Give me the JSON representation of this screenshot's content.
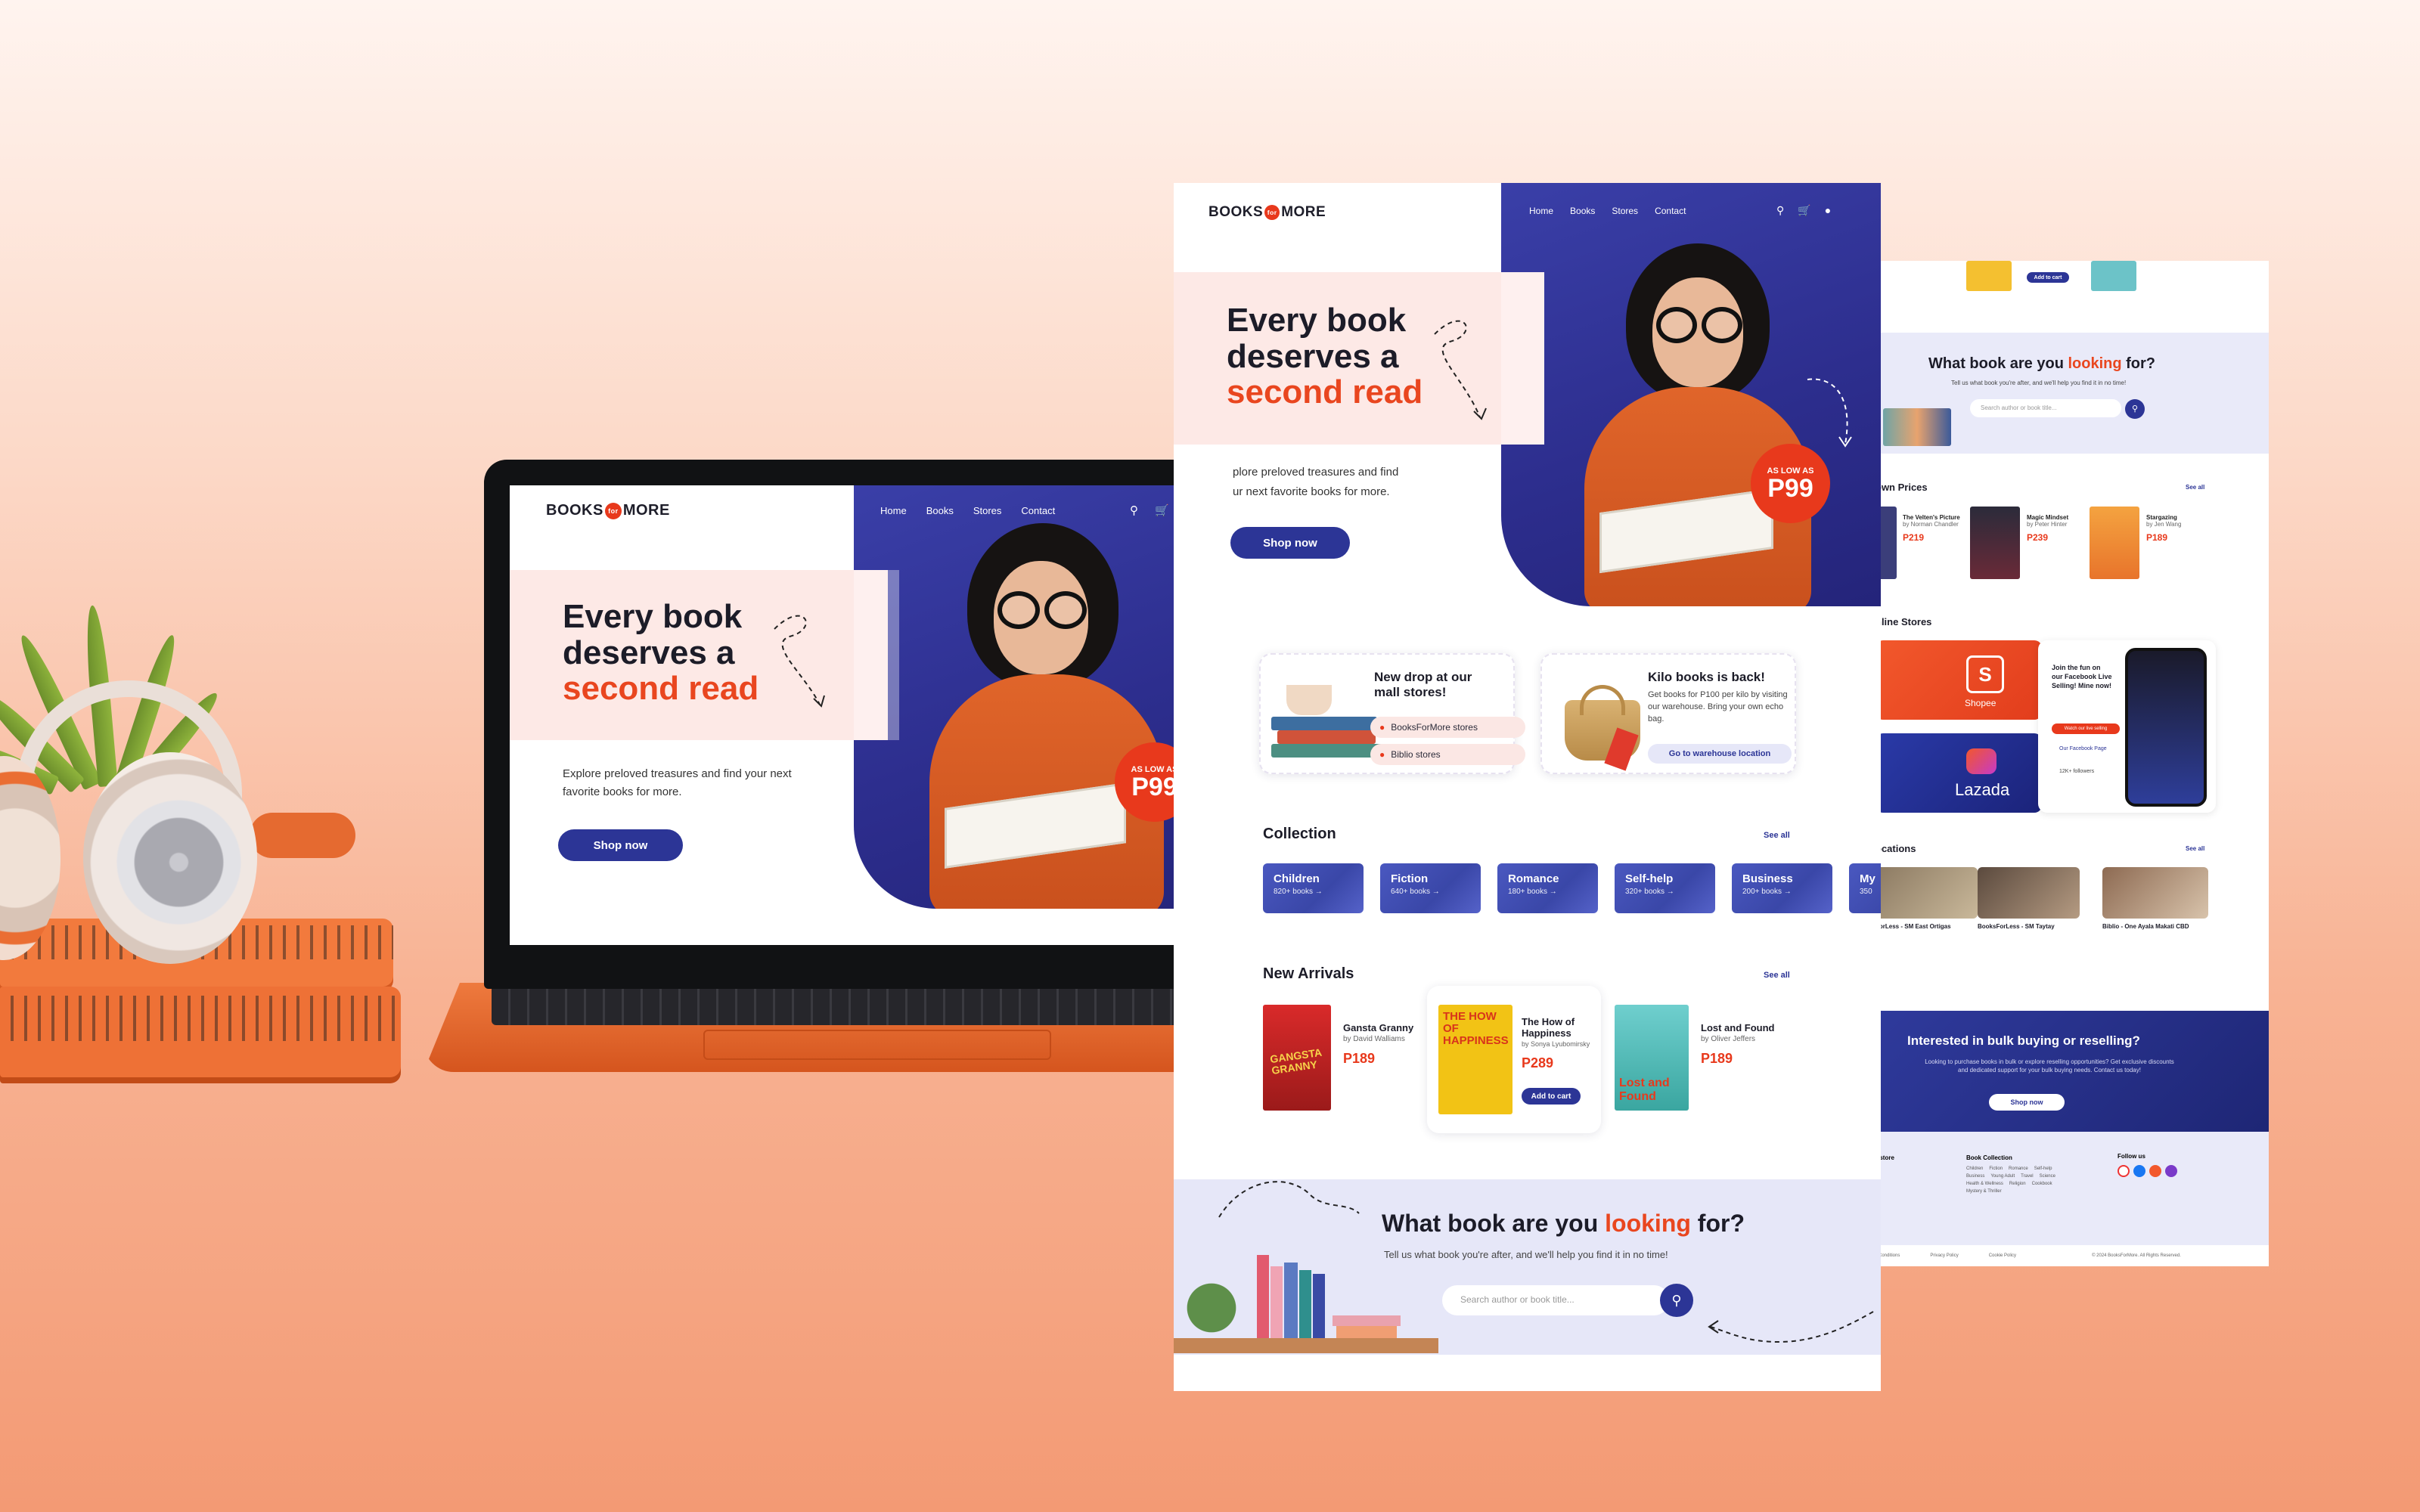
{
  "brand": {
    "name_left": "BOOKS",
    "name_mid": "for",
    "name_right": "MORE"
  },
  "nav": {
    "items": [
      "Home",
      "Books",
      "Stores",
      "Contact"
    ],
    "icons": [
      "search-icon",
      "cart-icon",
      "user-icon"
    ]
  },
  "hero": {
    "line1": "Every book",
    "line2": "deserves a",
    "line3": "second read",
    "subtitle": "Explore preloved treasures and find your next favorite books for more.",
    "subtitle_cut": "plore preloved treasures and find",
    "subtitle_cut2": "ur next favorite books for more.",
    "cta": "Shop now",
    "badge_small": "AS LOW AS",
    "badge_big": "P99"
  },
  "promos": {
    "mall": {
      "title": "New drop at our mall stores!",
      "stores": [
        "BooksForMore stores",
        "Biblio stores"
      ]
    },
    "kilo": {
      "title": "Kilo books is back!",
      "text": "Get books for P100 per kilo by visiting our warehouse. Bring your own echo bag.",
      "cta": "Go to warehouse location"
    }
  },
  "collection": {
    "title": "Collection",
    "see_all": "See all",
    "items": [
      {
        "name": "Children",
        "count": "820+ books →"
      },
      {
        "name": "Fiction",
        "count": "640+ books →"
      },
      {
        "name": "Romance",
        "count": "180+ books →"
      },
      {
        "name": "Self-help",
        "count": "320+ books →"
      },
      {
        "name": "Business",
        "count": "200+ books →"
      },
      {
        "name": "My",
        "count": "350"
      }
    ]
  },
  "arrivals": {
    "title": "New Arrivals",
    "see_all": "See all",
    "books": [
      {
        "title": "Gansta Granny",
        "author": "by David Walliams",
        "price": "P189",
        "cover_text": "GANGSTA GRANNY"
      },
      {
        "title": "The How of Happiness",
        "author": "by Sonya Lyubomirsky",
        "price": "P289",
        "cta": "Add to cart",
        "cover_text": "THE HOW OF HAPPINESS"
      },
      {
        "title": "Lost and Found",
        "author": "by Oliver Jeffers",
        "price": "P189",
        "cover_text": "Lost and Found"
      }
    ]
  },
  "finder": {
    "title_a": "What book are you",
    "title_accent": "looking",
    "title_b": "for?",
    "subtitle": "Tell us what book you're after, and we'll help you find it in no time!",
    "placeholder": "Search author or book title..."
  },
  "back_page": {
    "top_cta": "Add to cart",
    "finder_placeholder": "Search author or book title...",
    "markdown_title": "own Prices",
    "see_all": "See all",
    "markdown_books": [
      {
        "title": "The Velten's Picture",
        "author": "by Norman Chandler",
        "price": "P219"
      },
      {
        "title": "Magic Mindset",
        "author": "by Peter Hinter",
        "price": "P239"
      },
      {
        "title": "Stargazing",
        "author": "by Jen Wang",
        "price": "P189"
      }
    ],
    "online_title": "nline Stores",
    "shopee": "Shopee",
    "lazada": "Lazada",
    "live": {
      "title": "Join the fun on our Facebook Live Selling! Mine now!",
      "cta": "Watch our live selling",
      "page": "Our Facebook Page",
      "followers": "12K+ followers"
    },
    "locations_title": "ocations",
    "locations": [
      {
        "name": "ForLess - SM East Ortigas"
      },
      {
        "name": "BooksForLess - SM Taytay"
      },
      {
        "name": "Biblio - One Ayala Makati CBD"
      }
    ],
    "bulk": {
      "title": "Interested in bulk buying or reselling?",
      "text": "Looking to purchase books in bulk or explore reselling opportunities? Get exclusive discounts and dedicated support for your bulk buying needs. Contact us today!",
      "cta": "Shop now"
    },
    "footer": {
      "col1": "r store",
      "col2": "Book Collection",
      "col3": "Follow us",
      "links": [
        "Children",
        "Fiction",
        "Romance",
        "Self-help",
        "Business",
        "Young Adult",
        "Travel",
        "Science",
        "Health & Wellness",
        "Religion",
        "Cookbook",
        "Mystery & Thriller"
      ],
      "bottom": [
        "Conditions",
        "Privacy Policy",
        "Cookie Policy",
        "© 2024 BooksForMore. All Rights Reserved."
      ]
    }
  },
  "colors": {
    "accent": "#e8391c",
    "navy": "#2c3596",
    "hero_blue": "#2d2e8e",
    "pink": "#fde9e6",
    "lavender": "#e6e7f8"
  }
}
